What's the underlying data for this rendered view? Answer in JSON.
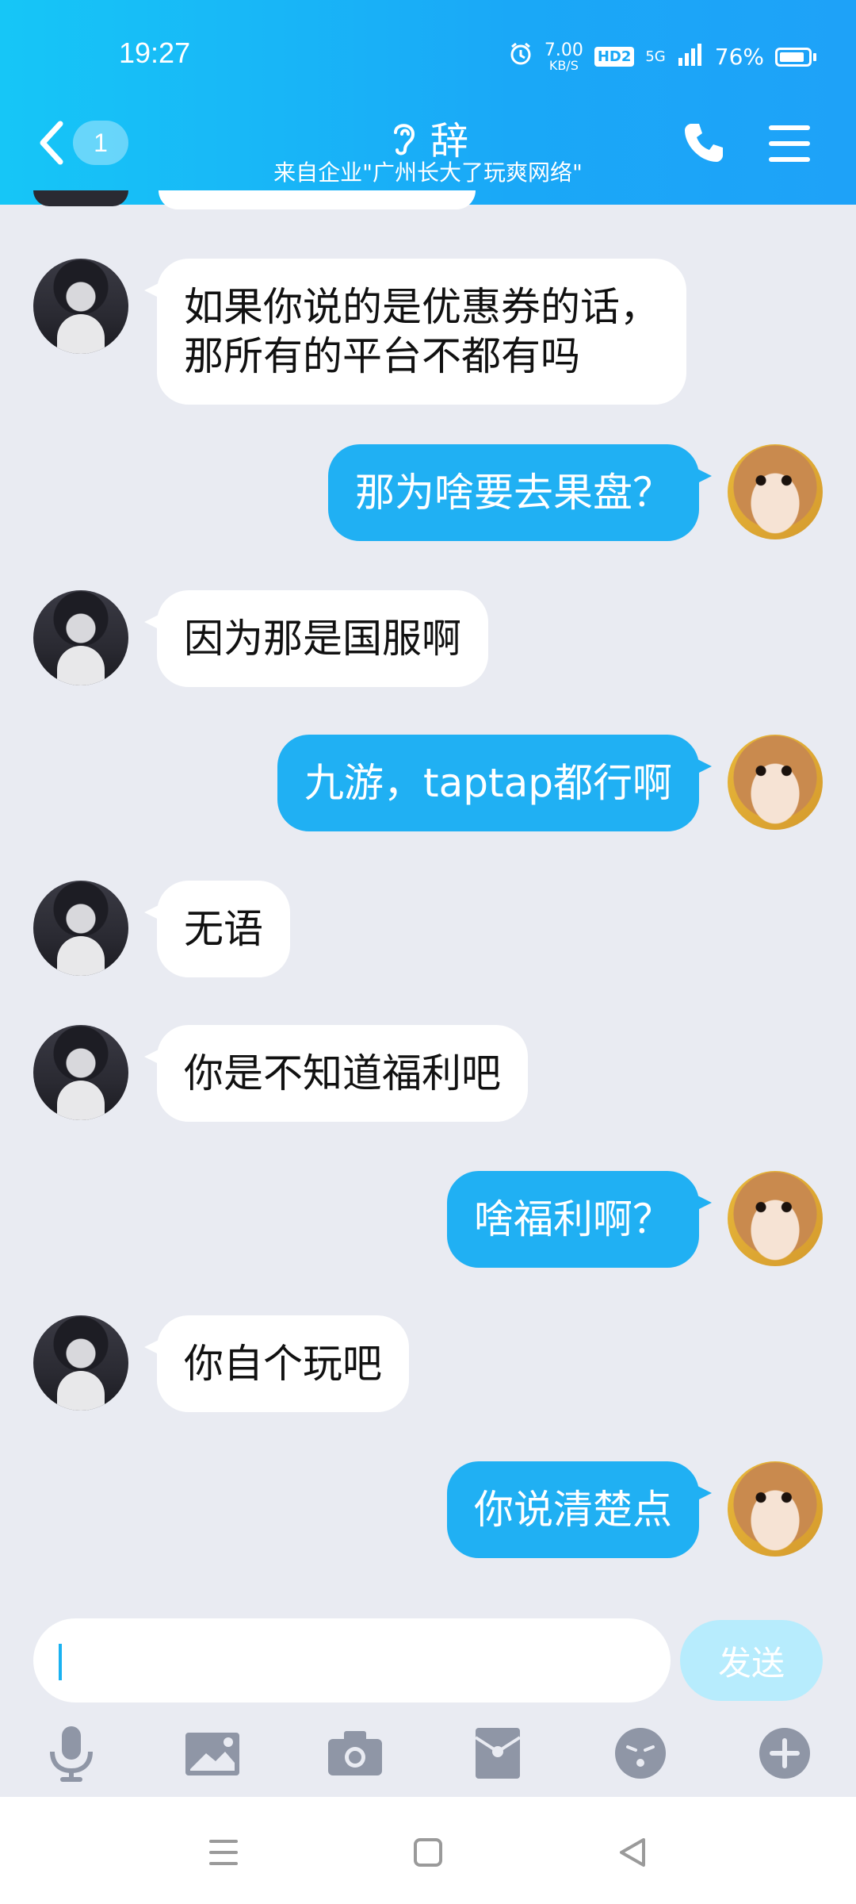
{
  "status_bar": {
    "time": "19:27",
    "net_speed_value": "7.00",
    "net_speed_unit": "KB/S",
    "hd_badge": "HD2",
    "network": "5G",
    "battery_percent": "76%",
    "battery_level": 0.76
  },
  "header": {
    "unread_count": "1",
    "title": "辞",
    "subtitle": "来自企业\"广州长大了玩爽网络\"",
    "icons": {
      "back": "chevron-left-icon",
      "listen": "ear-icon",
      "call": "phone-icon",
      "menu": "menu-icon"
    }
  },
  "messages": [
    {
      "side": "left",
      "text": "如果你说的是优惠券的话，\n那所有的平台不都有吗"
    },
    {
      "side": "right",
      "text": "那为啥要去果盘？"
    },
    {
      "side": "left",
      "text": "因为那是国服啊"
    },
    {
      "side": "right",
      "text": "九游，taptap都行啊"
    },
    {
      "side": "left",
      "text": "无语"
    },
    {
      "side": "left",
      "text": "你是不知道福利吧"
    },
    {
      "side": "right",
      "text": "啥福利啊？"
    },
    {
      "side": "left",
      "text": "你自个玩吧"
    },
    {
      "side": "right",
      "text": "你说清楚点"
    }
  ],
  "composer": {
    "input_value": "",
    "send_label": "发送"
  },
  "toolbar_icons": [
    "microphone-icon",
    "image-icon",
    "camera-icon",
    "red-envelope-icon",
    "emoji-icon",
    "plus-icon"
  ],
  "navbar_icons": [
    "menu-icon",
    "home-icon",
    "back-icon"
  ],
  "colors": {
    "header_start": "#16c6f7",
    "header_end": "#1ea2f8",
    "outgoing_bubble": "#20b0f3",
    "incoming_bubble": "#ffffff",
    "background": "#e9ebf2",
    "send_disabled": "#b7ecfd"
  }
}
